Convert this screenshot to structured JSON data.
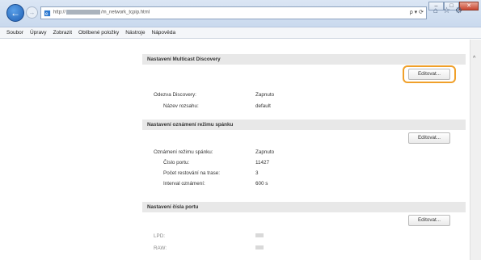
{
  "browser": {
    "address_prefix": "http://",
    "address_suffix": "/m_network_tcpip.html",
    "search_arrow": "ρ ▾ ⟳"
  },
  "menu": [
    "Soubor",
    "Úpravy",
    "Zobrazit",
    "Oblíbené položky",
    "Nástroje",
    "Nápověda"
  ],
  "sections": {
    "multicast": {
      "title": "Nastavení Multicast Discovery",
      "edit_label": "Editovat...",
      "rows": [
        {
          "label": "Odezva Discovery:",
          "value": "Zapnuto"
        },
        {
          "label": "Název rozsahu:",
          "value": "default"
        }
      ]
    },
    "sleep": {
      "title": "Nastavení oznámení režimu spánku",
      "edit_label": "Editovat...",
      "rows": [
        {
          "label": "Oznámení režimu spánku:",
          "value": "Zapnuto"
        },
        {
          "label": "Číslo portu:",
          "value": "11427"
        },
        {
          "label": "Počet restování na trase:",
          "value": "3"
        },
        {
          "label": "Interval oznámení:",
          "value": "600 s"
        }
      ]
    },
    "port": {
      "title": "Nastavení čísla portu",
      "edit_label": "Editovat...",
      "rows": [
        {
          "label": "LPD:"
        },
        {
          "label": "RAW:"
        }
      ]
    }
  },
  "colors": {
    "highlight": "#f0a02a",
    "section_header_bg": "#e8e8e8"
  },
  "icons": {
    "back": "arrow-left",
    "forward": "arrow-right",
    "home": "home",
    "favorites": "star",
    "settings": "gear"
  }
}
